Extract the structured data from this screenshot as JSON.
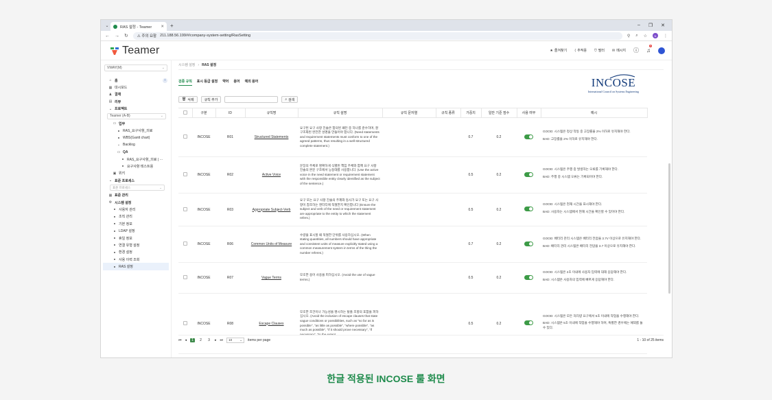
{
  "browser": {
    "tab_title": "RAS 설정 - Teamer",
    "warning": "⚠ 주의 요함",
    "url": "211.188.56.199/#/company-system-setting/RasSetting",
    "profile_initial": "N"
  },
  "header": {
    "logo": "Teamer",
    "favorites": "즐겨찾기",
    "track": "추적용",
    "filter": "필터",
    "message": "메시지",
    "badge": "9"
  },
  "sidebar": {
    "workspace": "VWAY(M)",
    "items": [
      {
        "label": "홈",
        "icon": "home-icon",
        "cls": "b"
      },
      {
        "label": "대시보드",
        "icon": "dashboard-icon",
        "cls": ""
      },
      {
        "label": "결재",
        "icon": "approval-icon",
        "cls": "b"
      },
      {
        "label": "리뷰",
        "icon": "review-icon",
        "cls": "b"
      },
      {
        "label": "프로젝트",
        "icon": "chevron-down-icon",
        "cls": "b"
      }
    ],
    "project_select": "Teamer (A-B)",
    "tree": [
      {
        "label": "업무",
        "cls": "sub b"
      },
      {
        "label": "RAS_요구사항_의료",
        "cls": "sub2"
      },
      {
        "label": "WBS(Gantt chart)",
        "cls": "sub2"
      },
      {
        "label": "Backlog",
        "cls": "sub2"
      },
      {
        "label": "QA",
        "cls": "sub2 b"
      },
      {
        "label": "RAS_요구사항_의료 | ···",
        "cls": "sub3"
      },
      {
        "label": "요구사항 테스트용",
        "cls": "sub3"
      },
      {
        "label": "위키",
        "cls": "sub"
      }
    ],
    "standard_process": "표준 프로세스",
    "standard_process_placeholder": "표준 프로세스",
    "standard_mgmt": "표준 관리",
    "system_settings": "시스템 설정",
    "settings_items": [
      {
        "label": "사용자 관리"
      },
      {
        "label": "조직 관리"
      },
      {
        "label": "기본 정보"
      },
      {
        "label": "LDAP 설정"
      },
      {
        "label": "휴일 정보"
      },
      {
        "label": "연결 유형 설정"
      },
      {
        "label": "환경 설정"
      },
      {
        "label": "사용 이력 조회"
      },
      {
        "label": "RAS 설정",
        "active": true
      }
    ]
  },
  "breadcrumb": {
    "parent": "시스템 설정",
    "current": "RAS 설정"
  },
  "tabs": [
    "검증 규칙",
    "표시 등급 설정",
    "약어",
    "용어",
    "예외 용어"
  ],
  "logo_incose": {
    "big": "INCOSE",
    "small": "International Council on Systems Engineering"
  },
  "toolbar": {
    "delete": "삭제",
    "add": "규칙 추가",
    "search": "검색"
  },
  "table": {
    "headers": [
      "구분",
      "ID",
      "규칙명",
      "규칙 설명",
      "규칙 문자열",
      "규칙 종류",
      "가중치",
      "일반 기준 점수",
      "사용 여부",
      "예시"
    ],
    "rows": [
      {
        "cat": "INCOSE",
        "id": "R01",
        "name": "Structured Statements",
        "desc": "요구된 요구 사항 진술은 합의된 패턴 중 하나를 준수하며, 잘 구조화된 완전한 성명을 만들어야 합니다. (Need statements and requirement statements must conform to one of the agreed patterns, thus resulting in a well-structured complete statement.)",
        "weight": "0.7",
        "score": "0.2",
        "good": "GOOD: 시스템은 정상 작동 중 고장률을 2% 이하로 유지해야 한다.",
        "bad": "BAD: 고장률을 2% 이하로 유지해야 한다."
      },
      {
        "cat": "INCOSE",
        "id": "R02",
        "name": "Active Voice",
        "desc": "문장의 주체로 명확하게 식별된 책임 주체와 함께 요구 사항 진술의 본문 구조에서 능동태를 사용합니다. (Use the active voice in the need statement or requirement statement with the responsible entity clearly identified as the subject of the sentence.)",
        "weight": "0.5",
        "score": "0.2",
        "good": "GOOD: 시스템은 주행 중 발생하는 오류를 기록해야 한다.",
        "bad": "BAD: 주행 중 시스템 오류는 기록되어야 한다."
      },
      {
        "cat": "INCOSE",
        "id": "R03",
        "name": "Appropriate Subject-Verb",
        "desc": "요구 또는 요구 사항 진술의 주제와 동사가 요구 또는 요구 사항이 참조하는 엔터티에 적절한지 확인합니다 (Ensure the subject and verb of the need or requirement statement are appropriate to the entity to which the statement refers.)",
        "weight": "0.5",
        "score": "0.2",
        "good": "GOOD: 시스템은 현재 시간을 표시해야 한다.",
        "bad": "BAD: 사용자는 시스템에서 현재 시간을 확인할 수 있어야 한다."
      },
      {
        "cat": "INCOSE",
        "id": "R06",
        "name": "Common Units of Measure",
        "desc": "수량을 표시할 때 적절한 단위를 사용하십시오. (When stating quantities, all numbers should have appropriate and consistent units of measure explicitly stated using a common measurement system in terms of the thing the number referes.)",
        "weight": "0.7",
        "score": "0.2",
        "good": "GOOD: 배터리 관리 시스템은 배터리 전압을 3.7V 이상으로 유지해야 한다.",
        "bad": "BAD: 배터리 관리 시스템은 배터리 전압을 3.7 이상으로 유지해야 한다."
      },
      {
        "cat": "INCOSE",
        "id": "R07",
        "name": "Vague Terms",
        "desc": "모호한 용어 사용을 피하십시오. (Avoid the use of vague terms.)",
        "weight": "0.5",
        "score": "0.2",
        "good": "GOOD: 시스템은 2초 이내에 사용자 입력에 대해 응답해야 한다.",
        "bad": "BAD: 시스템은 사용자의 입력에 빠르게 응답해야 한다."
      },
      {
        "cat": "INCOSE",
        "id": "R08",
        "name": "Escape Clauses",
        "desc": "모호한 조건이나 가능성을 명시하는 탈출 조항의 포함을 피하십시오. (Avoid the inclusion of escape clauses that state vague conditions or possibilities, such as \"so far as is possible\", \"as little as possible\", \"where possible\", \"as much as possible\", \"if it should prove necessary\", \"if necessary\", \"to the extent",
        "weight": "0.5",
        "score": "0.2",
        "good": "GOOD: 시스템은 모든 처리량 요구에서 5초 이내에 작업을 수행해야 한다.",
        "bad": "BAD: 시스템은 5초 이내에 작업을 수행해야 하며, 특별한 경우에는 예외를 둘 수 있다."
      }
    ]
  },
  "pager": {
    "pages": [
      "1",
      "2",
      "3"
    ],
    "page_size": "10",
    "items_per_page": "items per page",
    "summary": "1 - 10 of 25 items"
  },
  "caption": "한글 적용된 INCOSE 룰 화면",
  "colors": {
    "accent": "#1f8b4c",
    "toggle_on": "#3d9b47"
  }
}
